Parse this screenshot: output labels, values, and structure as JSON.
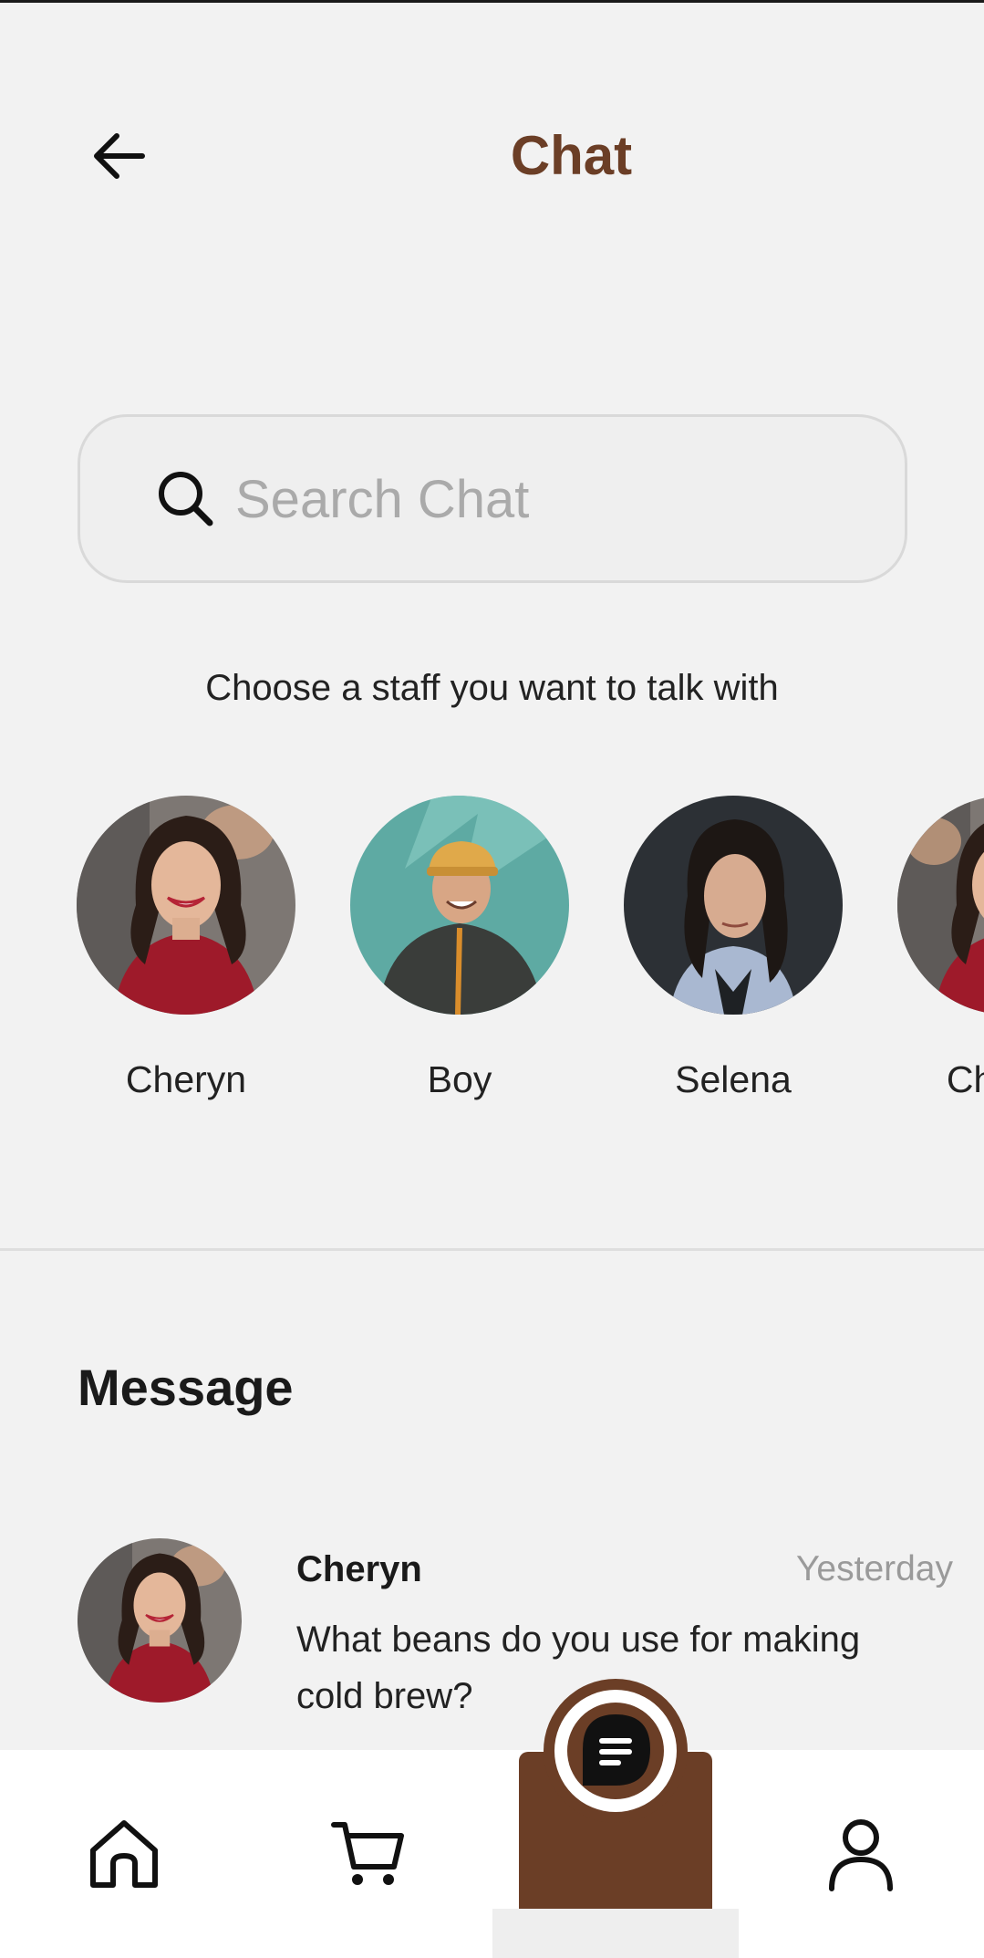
{
  "header": {
    "title": "Chat",
    "back_icon": "arrow-left-icon"
  },
  "search": {
    "placeholder": "Search Chat",
    "value": "",
    "icon": "search-icon"
  },
  "staff_section": {
    "hint": "Choose a staff you want to talk with",
    "staff": [
      {
        "name": "Cheryn"
      },
      {
        "name": "Boy"
      },
      {
        "name": "Selena"
      },
      {
        "name": "Cheryn"
      }
    ]
  },
  "messages": {
    "title": "Message",
    "items": [
      {
        "sender": "Cheryn",
        "time": "Yesterday",
        "preview": "What beans do you use for making cold brew?"
      }
    ]
  },
  "bottom_nav": {
    "items": [
      {
        "icon": "home-icon"
      },
      {
        "icon": "cart-icon"
      },
      {
        "icon": "chat-icon",
        "active": true
      },
      {
        "icon": "profile-icon"
      }
    ]
  },
  "colors": {
    "brand": "#6b3e26",
    "background": "#f2f2f2",
    "muted_text": "#9a9a9a"
  }
}
